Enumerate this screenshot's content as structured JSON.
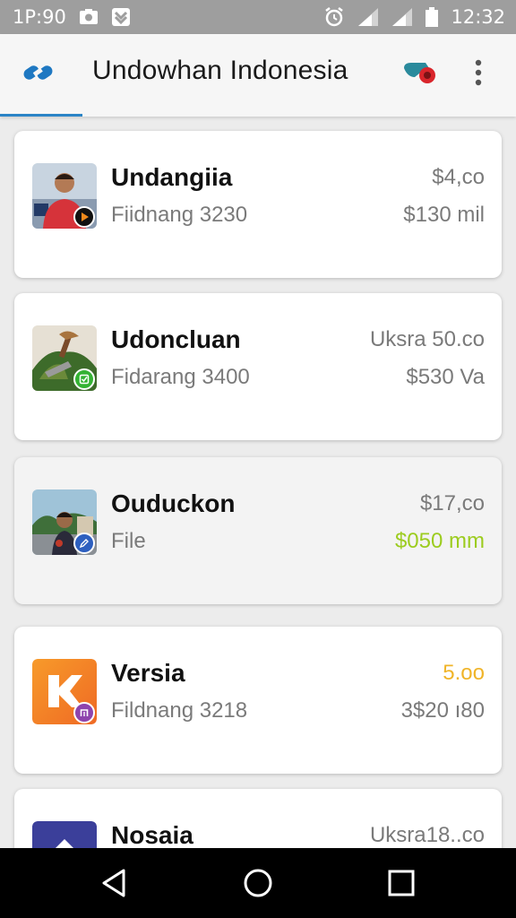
{
  "status_bar": {
    "time_left": "1P:90",
    "clock": "12:32",
    "icons": [
      "image-icon",
      "download-icon",
      "alarm-icon",
      "signal-icon",
      "signal-icon",
      "battery-icon"
    ]
  },
  "app_bar": {
    "title": "Undowhan Indonesia",
    "logo_icon": "link-logo-icon",
    "action_icon": "whistle-icon",
    "menu_icon": "more-vert-icon",
    "accent": "#2b84c6"
  },
  "items": [
    {
      "title": "Undangiia",
      "subtitle": "Fiidnang 3230",
      "price": "$4,co",
      "secondary": "$130 mil",
      "secondary_color": "#7a7a7a",
      "badge_icon": "play-icon"
    },
    {
      "title": "Udoncluan",
      "subtitle": "Fidarang 3400",
      "price": "Uksra 50.co",
      "secondary": "$530 Va",
      "secondary_color": "#7a7a7a",
      "badge_icon": "check-icon"
    },
    {
      "title": "Ouduckon",
      "subtitle": "File",
      "price": "$17,co",
      "secondary": "$050 mm",
      "secondary_color": "#9ccc1f",
      "badge_icon": "edit-icon"
    },
    {
      "title": "Versia",
      "subtitle": "Fildnang 3218",
      "price": "5.oo",
      "price_color": "#f0b428",
      "secondary": "3$20 ı80",
      "secondary_color": "#7a7a7a",
      "badge_icon": "app-icon"
    },
    {
      "title": "Nosaia",
      "subtitle": "",
      "price": "Uksra18..co",
      "secondary": "",
      "badge_icon": ""
    }
  ],
  "nav_bar": {
    "icons": [
      "back-icon",
      "home-icon",
      "recents-icon"
    ]
  }
}
